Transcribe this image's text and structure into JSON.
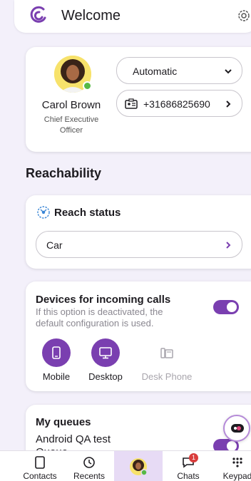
{
  "header": {
    "title": "Welcome"
  },
  "profile": {
    "name": "Carol Brown",
    "role": "Chief Executive Officer",
    "mode": "Automatic",
    "phone": "+31686825690"
  },
  "reachability": {
    "section_title": "Reachability",
    "status_title": "Reach status",
    "status_value": "Car"
  },
  "devices": {
    "title": "Devices for incoming calls",
    "subtitle": "If this option is deactivated, the default configuration is used.",
    "enabled": true,
    "items": [
      {
        "label": "Mobile",
        "active": true
      },
      {
        "label": "Desktop",
        "active": true
      },
      {
        "label": "Desk Phone",
        "active": false
      }
    ]
  },
  "queues": {
    "title": "My queues",
    "items": [
      {
        "label": "Android QA test Queue",
        "enabled": true
      }
    ]
  },
  "nav": {
    "contacts": "Contacts",
    "recents": "Recents",
    "chats": "Chats",
    "chats_badge": "1",
    "keypad": "Keypad"
  },
  "colors": {
    "accent": "#7a3fb0",
    "presence": "#57b946",
    "badge": "#d93c3c"
  }
}
